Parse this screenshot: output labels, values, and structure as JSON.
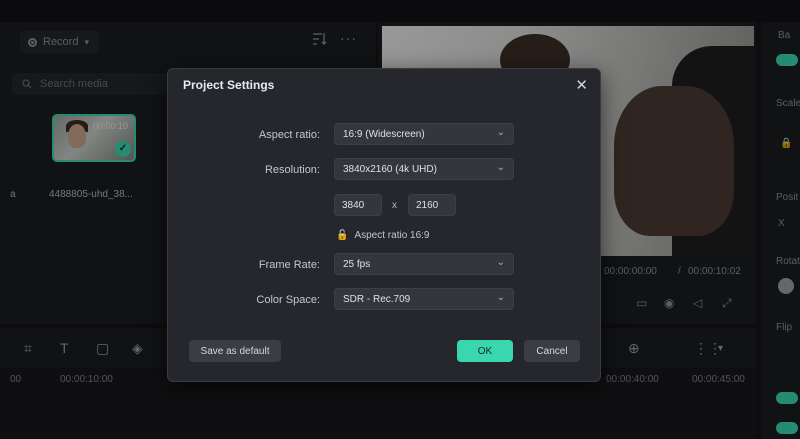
{
  "media": {
    "record_label": "Record",
    "search_placeholder": "Search media",
    "thumb_duration": "00:00:10",
    "thumb_label": "4488805-uhd_38...",
    "left_cut_label": "a"
  },
  "preview": {
    "time_current": "00:00:00:00",
    "time_separator": "/",
    "time_total": "00:00:10:02"
  },
  "properties": {
    "basic_label": "Ba",
    "scale_label": "Scale",
    "position_label": "Posit",
    "x_label": "X",
    "rotate_label": "Rotat",
    "flip_label": "Flip"
  },
  "timeline": {
    "ruler": [
      "00",
      "00:00:10:00",
      "00:00:40:00",
      "00:00:45:00"
    ]
  },
  "dialog": {
    "title": "Project Settings",
    "aspect_ratio_label": "Aspect ratio:",
    "aspect_ratio_value": "16:9 (Widescreen)",
    "resolution_label": "Resolution:",
    "resolution_value": "3840x2160 (4k UHD)",
    "width_value": "3840",
    "x_separator": "x",
    "height_value": "2160",
    "aspect_lock_text": "Aspect ratio 16:9",
    "frame_rate_label": "Frame Rate:",
    "frame_rate_value": "25 fps",
    "color_space_label": "Color Space:",
    "color_space_value": "SDR - Rec.709",
    "save_default_label": "Save as default",
    "ok_label": "OK",
    "cancel_label": "Cancel"
  },
  "colors": {
    "accent": "#3ad6b0",
    "background": "#141518",
    "dialog_bg": "#26272c"
  }
}
